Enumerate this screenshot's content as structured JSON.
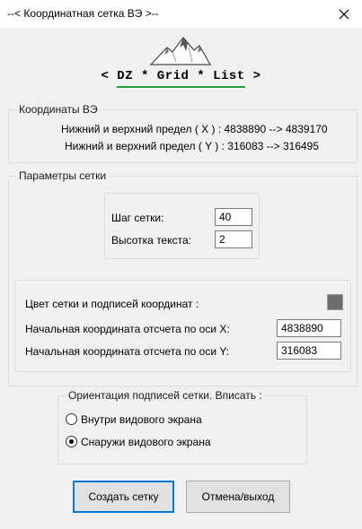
{
  "window": {
    "title": "--< Координатная сетка ВЭ >--"
  },
  "logo": {
    "text": "< DZ * Grid * List >"
  },
  "coords": {
    "legend": "Координаты ВЭ",
    "x_line": "Нижний и верхний предел ( X ) : 4838890  -->  4839170",
    "y_line": "Нижний и верхний предел ( Y ) : 316083  -->  316495"
  },
  "grid": {
    "legend": "Параметры сетки",
    "step_label": "Шаг сетки:",
    "step_value": "40",
    "text_height_label": "Высотка текста:",
    "text_height_value": "2",
    "color_label": "Цвет сетки и подписей координат :",
    "color_value": "#6d6d6d",
    "start_x_label": "Начальная координата отсчета по оси X:",
    "start_x_value": "4838890",
    "start_y_label": "Начальная координата отсчета по оси Y:",
    "start_y_value": "316083"
  },
  "orientation": {
    "legend": "Ориентация подписей сетки. Вписать :",
    "inside_label": "Внутри видового экрана",
    "outside_label": "Снаружи видового экрана",
    "selected": "outside"
  },
  "buttons": {
    "create": "Создать сетку",
    "cancel": "Отмена/выход"
  },
  "icons": {
    "close": "close-icon",
    "logo": "mountain-icon"
  }
}
